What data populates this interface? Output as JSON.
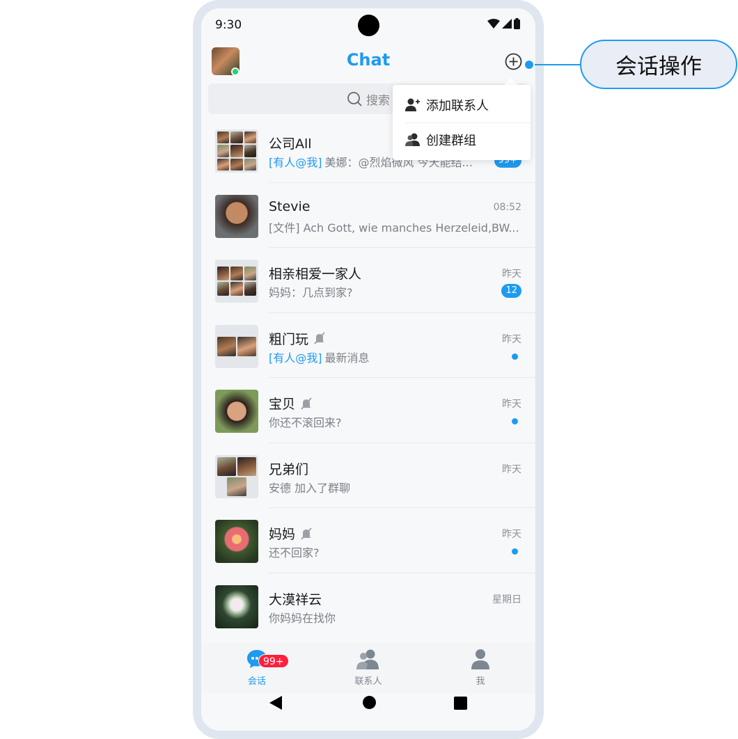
{
  "status_bar": {
    "time": "9:30"
  },
  "header": {
    "title": "Chat"
  },
  "search": {
    "placeholder": "搜索"
  },
  "dropdown": {
    "items": [
      {
        "label": "添加联系人",
        "icon": "add-contact-icon"
      },
      {
        "label": "创建群组",
        "icon": "create-group-icon"
      }
    ]
  },
  "chats": [
    {
      "name": "公司All",
      "mention": "[有人@我]",
      "preview": "美娜：@烈焰微风 今天能结...",
      "time": "",
      "badge": "99+",
      "muted": false,
      "unread_dot": false
    },
    {
      "name": "Stevie",
      "mention": "",
      "preview": "[文件] Ach Gott, wie manches Herzeleid,BW...",
      "time": "08:52",
      "badge": "",
      "muted": false,
      "unread_dot": false
    },
    {
      "name": "相亲相爱一家人",
      "mention": "",
      "preview": "妈妈：几点到家?",
      "time": "昨天",
      "badge": "12",
      "muted": false,
      "unread_dot": false
    },
    {
      "name": "粗门玩",
      "mention": "[有人@我]",
      "preview": "最新消息",
      "time": "昨天",
      "badge": "",
      "muted": true,
      "unread_dot": true
    },
    {
      "name": "宝贝",
      "mention": "",
      "preview": "你还不滚回来?",
      "time": "昨天",
      "badge": "",
      "muted": true,
      "unread_dot": true
    },
    {
      "name": "兄弟们",
      "mention": "",
      "preview": "安德 加入了群聊",
      "time": "昨天",
      "badge": "",
      "muted": false,
      "unread_dot": false
    },
    {
      "name": "妈妈",
      "mention": "",
      "preview": "还不回家?",
      "time": "昨天",
      "badge": "",
      "muted": true,
      "unread_dot": true
    },
    {
      "name": "大漠祥云",
      "mention": "",
      "preview": "你妈妈在找你",
      "time": "星期日",
      "badge": "",
      "muted": false,
      "unread_dot": false
    }
  ],
  "tabbar": {
    "tabs": [
      {
        "label": "会话",
        "icon": "chat-bubble-icon",
        "active": true,
        "badge": "99+"
      },
      {
        "label": "联系人",
        "icon": "contacts-icon",
        "active": false,
        "badge": ""
      },
      {
        "label": "我",
        "icon": "person-icon",
        "active": false,
        "badge": ""
      }
    ]
  },
  "callout": {
    "label": "会话操作"
  },
  "colors": {
    "accent": "#1d9bf0",
    "badge_red": "#ff1f3d",
    "online": "#23d36b"
  }
}
